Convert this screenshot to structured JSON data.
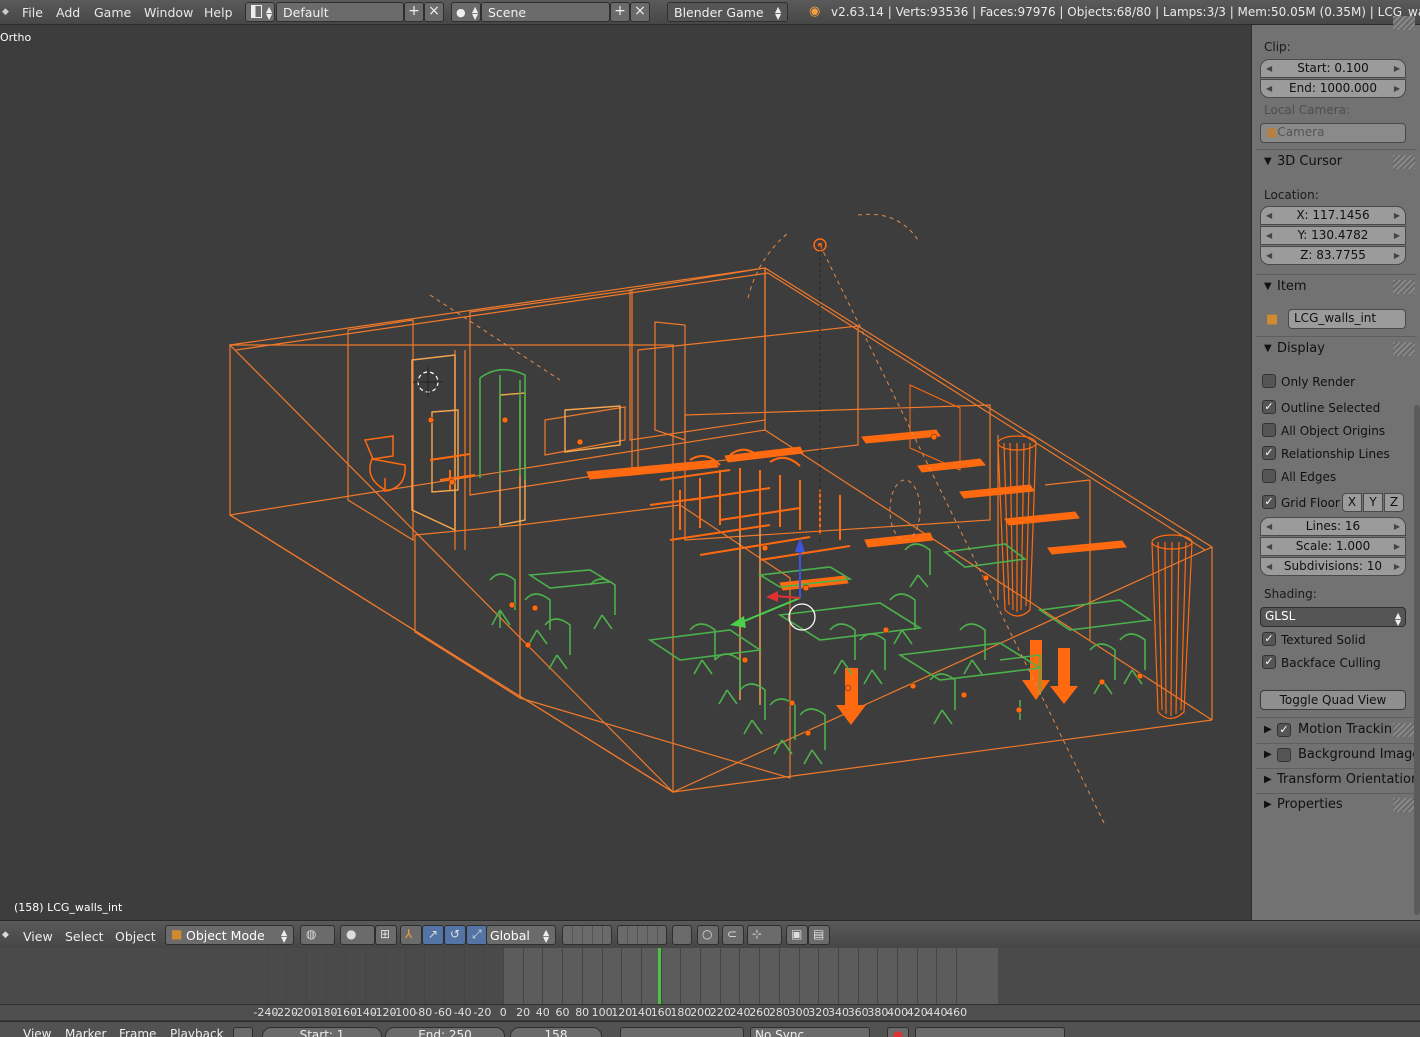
{
  "topbar": {
    "menus": [
      "File",
      "Add",
      "Game",
      "Window",
      "Help"
    ],
    "layout": "Default",
    "scene": "Scene",
    "engine": "Blender Game",
    "stats": "v2.63.14 | Verts:93536 | Faces:97976 | Objects:68/80 | Lamps:3/3 | Mem:50.05M (0.35M) | LCG_walls_int"
  },
  "viewport": {
    "projection": "Ortho",
    "object_info": "(158) LCG_walls_int"
  },
  "sidebar": {
    "clip": {
      "label": "Clip:",
      "start": "Start: 0.100",
      "end": "End: 1000.000"
    },
    "local_camera": {
      "label": "Local Camera:",
      "value": "Camera"
    },
    "cursor_panel": {
      "title": "3D Cursor",
      "location_label": "Location:",
      "x": "X: 117.1456",
      "y": "Y: 130.4782",
      "z": "Z: 83.7755"
    },
    "item_panel": {
      "title": "Item",
      "name": "LCG_walls_int"
    },
    "display_panel": {
      "title": "Display",
      "checks": [
        {
          "label": "Only Render",
          "checked": false
        },
        {
          "label": "Outline Selected",
          "checked": true
        },
        {
          "label": "All Object Origins",
          "checked": false
        },
        {
          "label": "Relationship Lines",
          "checked": true
        },
        {
          "label": "All Edges",
          "checked": false
        }
      ],
      "grid_floor": {
        "label": "Grid Floor",
        "checked": true,
        "axes": [
          "X",
          "Y",
          "Z"
        ]
      },
      "lines": "Lines: 16",
      "scale": "Scale: 1.000",
      "subdivisions": "Subdivisions: 10",
      "shading_label": "Shading:",
      "shading": "GLSL",
      "textured_solid": {
        "label": "Textured Solid",
        "checked": true
      },
      "backface_culling": {
        "label": "Backface Culling",
        "checked": true
      },
      "quad_view_btn": "Toggle Quad View"
    },
    "collapsed_panels": [
      {
        "title": "Motion Tracking",
        "has_check": true,
        "checked": true
      },
      {
        "title": "Background Images",
        "has_check": true,
        "checked": false
      },
      {
        "title": "Transform Orientations",
        "has_check": false
      },
      {
        "title": "Properties",
        "has_check": false
      }
    ]
  },
  "view_header": {
    "menus": [
      "View",
      "Select",
      "Object"
    ],
    "mode": "Object Mode",
    "orientation": "Global"
  },
  "timeline": {
    "ticks": [
      "-240",
      "-220",
      "-200",
      "-180",
      "-160",
      "-140",
      "-120",
      "-100",
      "-80",
      "-60",
      "-40",
      "-20",
      "0",
      "20",
      "40",
      "60",
      "80",
      "100",
      "120",
      "140",
      "160",
      "180",
      "200",
      "220",
      "240",
      "260",
      "280",
      "300",
      "320",
      "340",
      "360",
      "380",
      "400",
      "420",
      "440",
      "460"
    ],
    "current_frame": 158,
    "header": {
      "menus": [
        "View",
        "Marker",
        "Frame",
        "Playback"
      ],
      "start": "Start: 1",
      "end": "End: 250",
      "frame": "158",
      "sync": "No Sync"
    }
  },
  "colors": {
    "selected_orange": "#f0792a",
    "active_orange": "#ff6a10",
    "light_orange": "#f7a64f",
    "green_objects": "#4cb04c",
    "viewport_bg": "#3d3d3d",
    "sidebar_bg": "#727272",
    "current_frame_line": "#4ec243"
  }
}
